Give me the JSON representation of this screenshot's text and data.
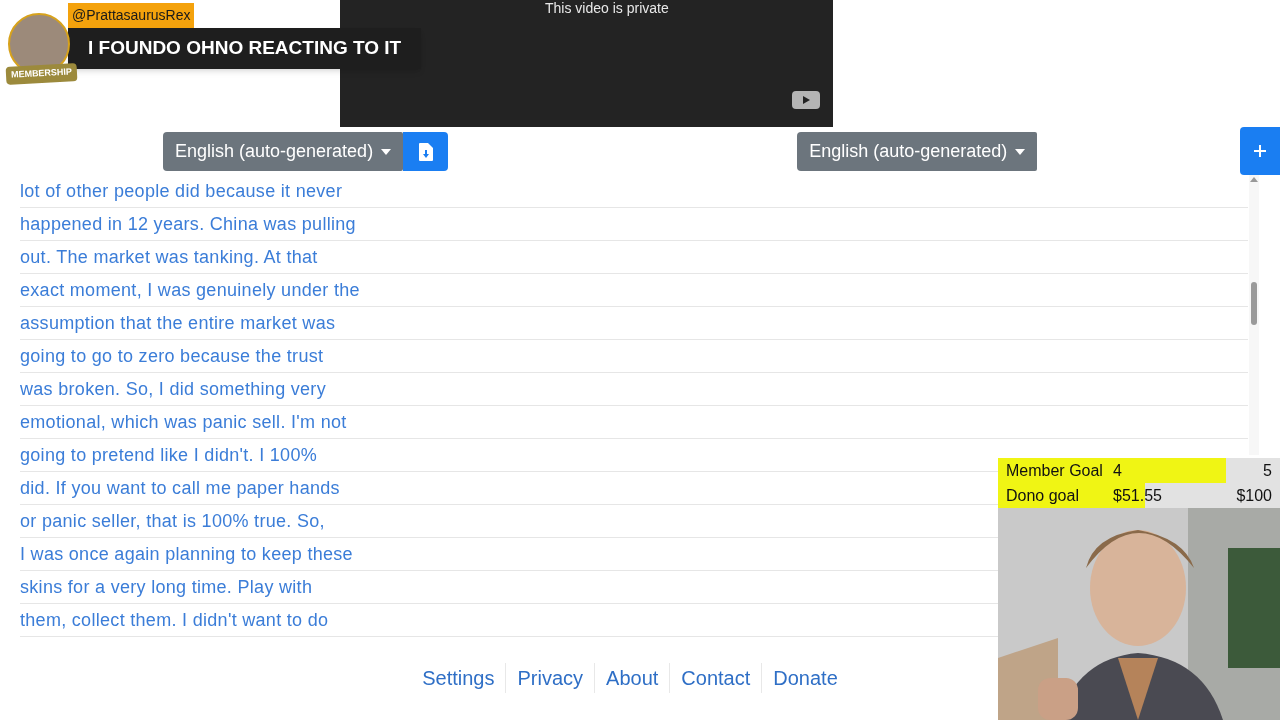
{
  "video": {
    "message": "This video is private"
  },
  "caption_controls": [
    {
      "label": "English (auto-generated)",
      "download": true
    },
    {
      "label": "English (auto-generated)",
      "download": false
    }
  ],
  "transcript": [
    "lot of other people did because it never",
    "happened in 12 years. China was pulling",
    "out. The market was tanking. At that",
    "exact moment, I was genuinely under the",
    "assumption that the entire market was",
    "going to go to zero because the trust",
    "was broken. So, I did something very",
    "emotional, which was panic sell. I'm not",
    "going to pretend like I didn't. I 100%",
    "did. If you want to call me paper hands",
    "or panic seller, that is 100% true. So,",
    "I was once again planning to keep these",
    "skins for a very long time. Play with",
    "them, collect them. I didn't want to do"
  ],
  "footer_links": [
    "Settings",
    "Privacy",
    "About",
    "Contact",
    "Donate"
  ],
  "chat_highlight": {
    "username": "@PrattasaurusRex",
    "badge": "MEMBERSHIP",
    "message": "I FOUNDO OHNO REACTING TO IT"
  },
  "goals": [
    {
      "label": "Member Goal",
      "current": "4",
      "target": "5",
      "level": 0.81
    },
    {
      "label": "Dono goal",
      "current": "$51.55",
      "target": "$100",
      "level": 0.52
    }
  ]
}
